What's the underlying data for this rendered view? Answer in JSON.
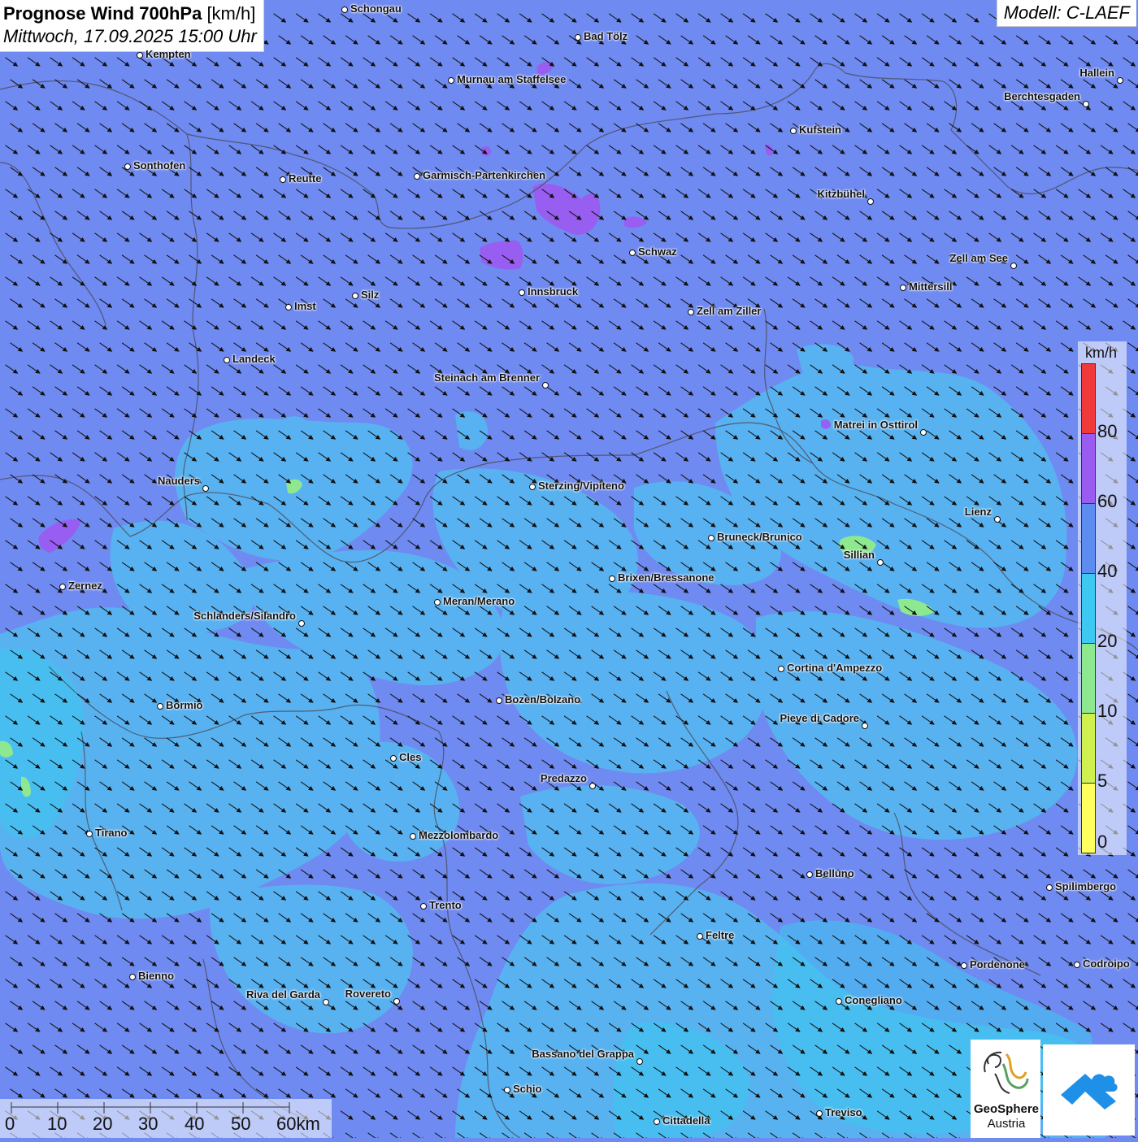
{
  "header": {
    "title_bold": "Prognose Wind 700hPa",
    "title_unit": "[km/h]",
    "datetime": "Mittwoch, 17.09.2025 15:00 Uhr",
    "model": "Modell: C-LAEF"
  },
  "legend": {
    "unit": "km/h",
    "classes": [
      {
        "label": "80",
        "color": "#f03a3a"
      },
      {
        "label": "60",
        "color": "#9a5cf0"
      },
      {
        "label": "40",
        "color": "#5c8cf0"
      },
      {
        "label": "20",
        "color": "#3cc8f0"
      },
      {
        "label": "10",
        "color": "#8ee890"
      },
      {
        "label": "5",
        "color": "#d0f050"
      },
      {
        "label": "0",
        "color": "#ffff60"
      }
    ]
  },
  "scalebar": {
    "labels": [
      "0",
      "10",
      "20",
      "30",
      "40",
      "50",
      "60km"
    ]
  },
  "wind": {
    "direction_deg": 300,
    "note_color_background": "#6f8af0"
  },
  "cities": [
    {
      "name": "Schongau"
    },
    {
      "name": "Bad Tölz"
    },
    {
      "name": "Kempten"
    },
    {
      "name": "Murnau am Staffelsee"
    },
    {
      "name": "Hallein"
    },
    {
      "name": "Berchtesgaden"
    },
    {
      "name": "Kufstein"
    },
    {
      "name": "Sonthofen"
    },
    {
      "name": "Reutte"
    },
    {
      "name": "Garmisch-Partenkirchen"
    },
    {
      "name": "Kitzbühel"
    },
    {
      "name": "Schwaz"
    },
    {
      "name": "Zell am See"
    },
    {
      "name": "Mittersill"
    },
    {
      "name": "Silz"
    },
    {
      "name": "Innsbruck"
    },
    {
      "name": "Imst"
    },
    {
      "name": "Zell am Ziller"
    },
    {
      "name": "Landeck"
    },
    {
      "name": "Steinach am Brenner"
    },
    {
      "name": "Matrei in Osttirol"
    },
    {
      "name": "Nauders"
    },
    {
      "name": "Sterzing/Vipiteno"
    },
    {
      "name": "Lienz"
    },
    {
      "name": "Bruneck/Brunico"
    },
    {
      "name": "Sillian"
    },
    {
      "name": "Zernez"
    },
    {
      "name": "Brixen/Bressanone"
    },
    {
      "name": "Meran/Merano"
    },
    {
      "name": "Schlanders/Silandro"
    },
    {
      "name": "Cortina d'Ampezzo"
    },
    {
      "name": "Bozen/Bolzano"
    },
    {
      "name": "Bormio"
    },
    {
      "name": "Pieve di Cadore"
    },
    {
      "name": "Cles"
    },
    {
      "name": "Predazzo"
    },
    {
      "name": "Tirano"
    },
    {
      "name": "Mezzolombardo"
    },
    {
      "name": "Belluno"
    },
    {
      "name": "Spilimbergo"
    },
    {
      "name": "Trento"
    },
    {
      "name": "Feltre"
    },
    {
      "name": "Bienno"
    },
    {
      "name": "Pordenone"
    },
    {
      "name": "Codroipo"
    },
    {
      "name": "Riva del Garda"
    },
    {
      "name": "Rovereto"
    },
    {
      "name": "Conegliano"
    },
    {
      "name": "Bassano del Grappa"
    },
    {
      "name": "Schio"
    },
    {
      "name": "Treviso"
    },
    {
      "name": "Cittadella"
    }
  ],
  "logos": {
    "geosphere_line1": "GeoSphere",
    "geosphere_line2": "Austria"
  }
}
